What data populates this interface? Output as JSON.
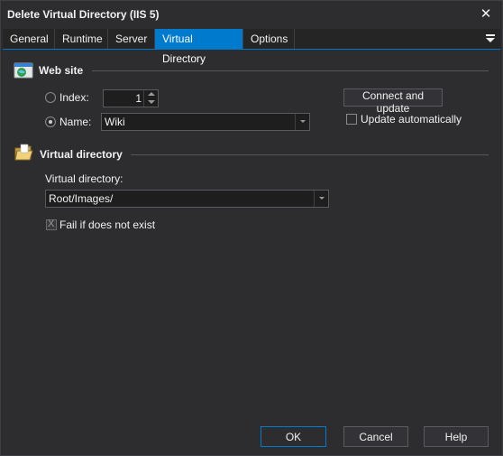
{
  "window": {
    "title": "Delete Virtual Directory (IIS 5)",
    "close_glyph": "✕"
  },
  "tabs": [
    {
      "label": "General"
    },
    {
      "label": "Runtime"
    },
    {
      "label": "Server"
    },
    {
      "label": "Virtual Directory",
      "active": true
    },
    {
      "label": "Options"
    }
  ],
  "web_site": {
    "heading": "Web site",
    "index_label": "Index:",
    "index_value": "1",
    "index_selected": false,
    "name_label": "Name:",
    "name_value": "Wiki",
    "name_selected": true,
    "connect_button": "Connect and update",
    "update_auto_label": "Update automatically",
    "update_auto_checked": false
  },
  "virtual_directory": {
    "heading": "Virtual directory",
    "field_label": "Virtual directory:",
    "value": "Root/Images/",
    "fail_label": "Fail if does not exist",
    "fail_checked": true,
    "fail_mark": "X"
  },
  "buttons": {
    "ok": "OK",
    "cancel": "Cancel",
    "help": "Help"
  },
  "colors": {
    "accent": "#007acc",
    "background": "#2d2d30"
  }
}
